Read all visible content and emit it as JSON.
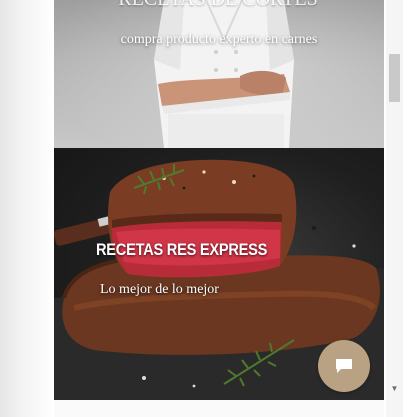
{
  "hero_panel": {
    "partial_title": "RECETAS DE CORTES",
    "subtitle": "compra producto experto en carnes"
  },
  "recipes_panel": {
    "title": "RECETAS RES EXPRESS",
    "tagline": "Lo mejor de lo mejor"
  },
  "chat": {
    "icon": "chat-bubble-icon"
  },
  "colors": {
    "chat_button": "#b9a183",
    "scroll_thumb": "#c9c9c9"
  }
}
